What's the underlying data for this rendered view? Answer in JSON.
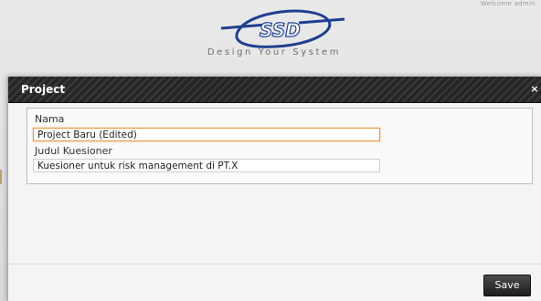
{
  "header": {
    "top_right_text": "Welcome admin",
    "logo_text": "SSD",
    "tagline": "Design Your System"
  },
  "dialog": {
    "title": "Project",
    "close_label": "×",
    "fields": [
      {
        "label": "Nama",
        "value": "Project Baru (Edited)"
      },
      {
        "label": "Judul Kuesioner",
        "value": "Kuesioner untuk risk management di PT.X"
      }
    ],
    "save_label": "Save"
  },
  "colors": {
    "header_bg": "#2f2f2f",
    "focus_border": "#e39b3c",
    "logo_blue": "#1f3f8f"
  }
}
